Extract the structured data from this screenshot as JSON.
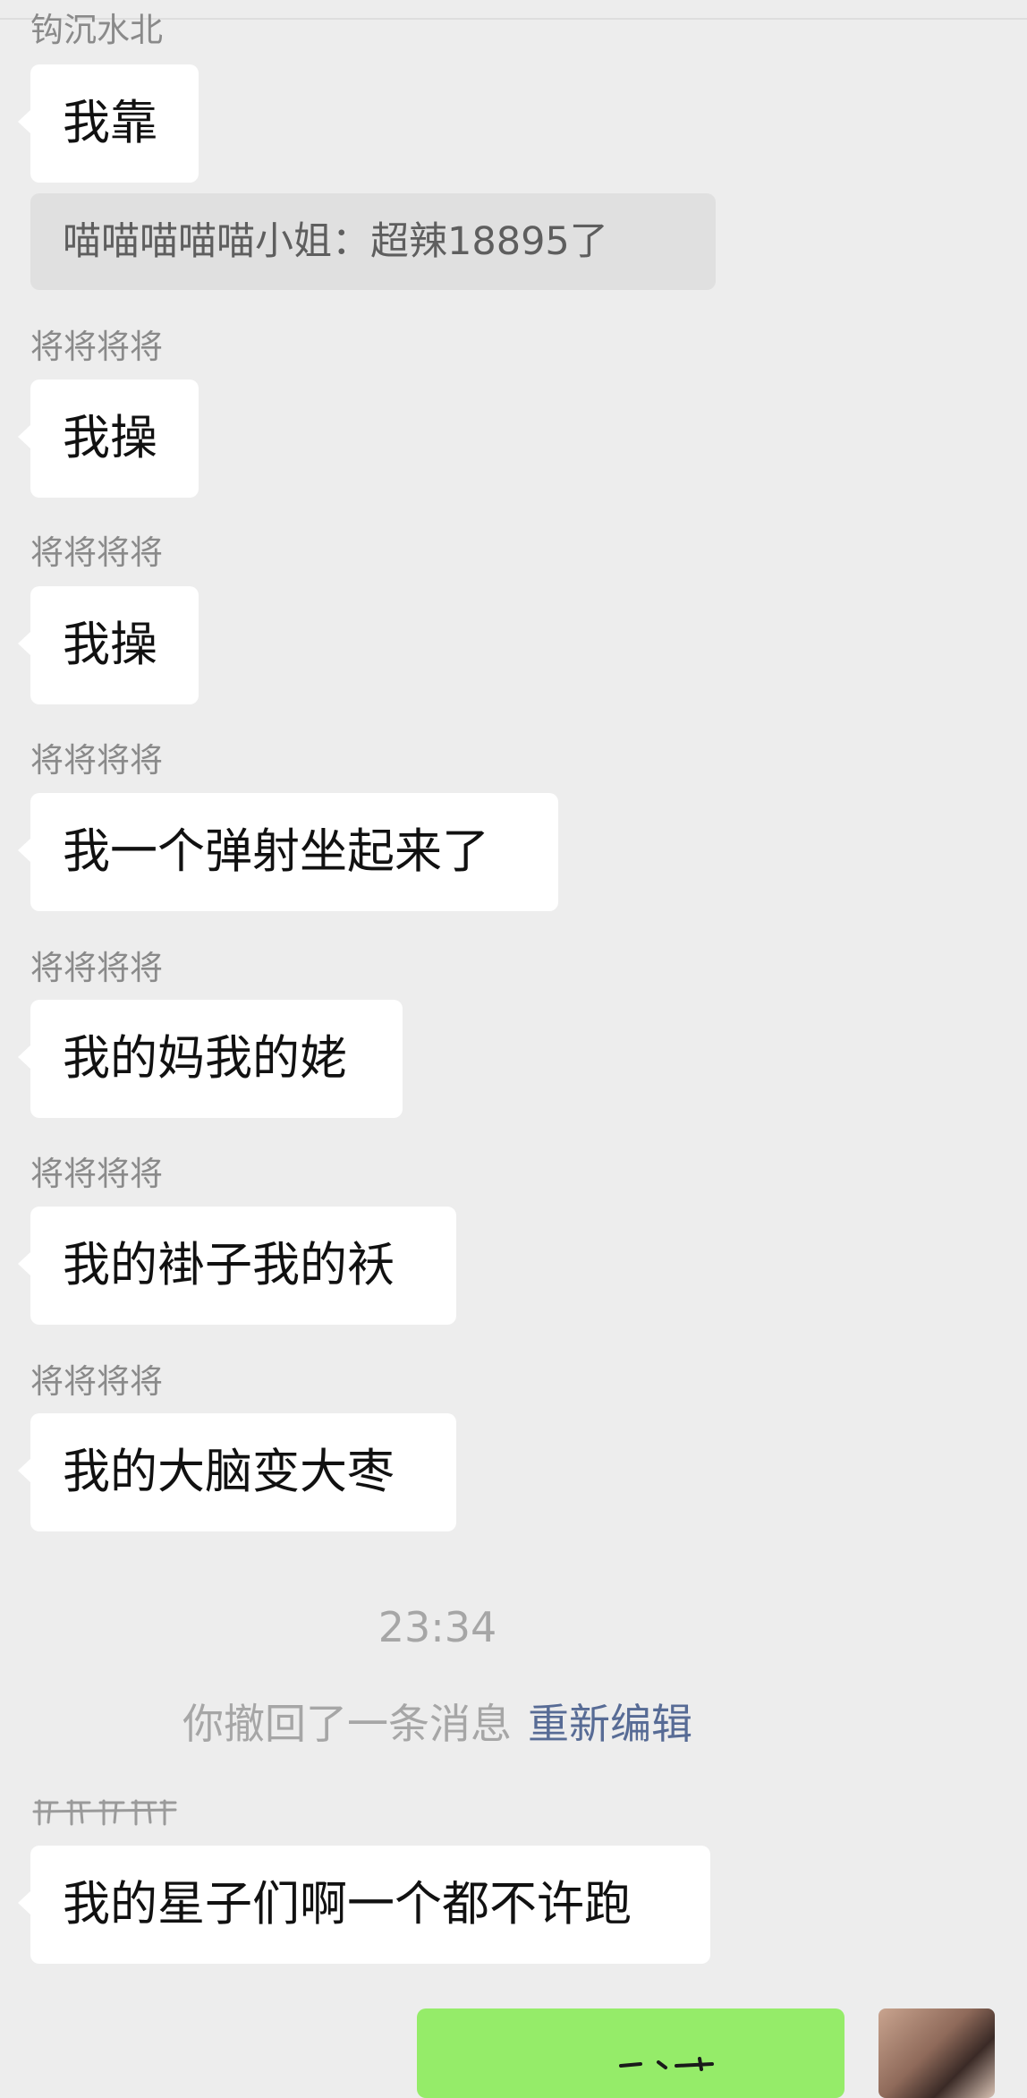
{
  "messages": [
    {
      "sender": "钩沉水北",
      "text": "我靠"
    },
    {
      "quote": "喵喵喵喵喵小姐：超辣18895了"
    },
    {
      "sender": "将将将将",
      "text": "我操"
    },
    {
      "sender": "将将将将",
      "text": "我操"
    },
    {
      "sender": "将将将将",
      "text": "我一个弹射坐起来了"
    },
    {
      "sender": "将将将将",
      "text": "我的妈我的姥"
    },
    {
      "sender": "将将将将",
      "text": "我的褂子我的袄"
    },
    {
      "sender": "将将将将",
      "text": "我的大脑变大枣"
    }
  ],
  "timestamp": "23:34",
  "recall": {
    "text": "你撤回了一条消息",
    "action_label": "重新编辑"
  },
  "last_message": {
    "text": "我的星子们啊一个都不许跑"
  }
}
